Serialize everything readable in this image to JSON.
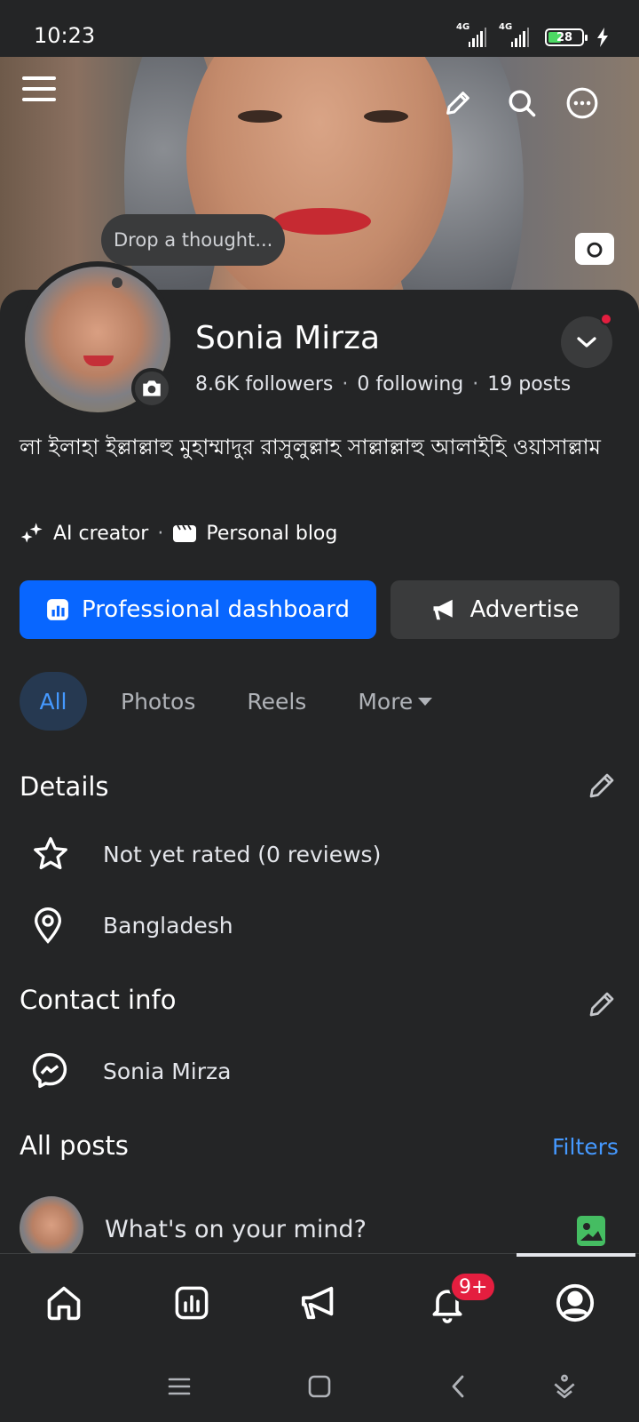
{
  "status_bar": {
    "time": "10:23",
    "signal_1": "4G",
    "signal_2": "4G",
    "battery": "28"
  },
  "cover": {
    "thought_placeholder": "Drop a thought..."
  },
  "profile": {
    "name": "Sonia Mirza",
    "followers": "8.6K followers",
    "following": "0 following",
    "posts": "19 posts",
    "stats_separator": "·",
    "bio": "লা ইলাহা ইল্লাল্লাহু মুহাম্মাদুর রাসুলুল্লাহ সাল্লাল্লাহু আলাইহি ওয়াসাল্লাম",
    "tags": [
      "AI creator",
      "Personal blog"
    ],
    "tag_separator": "·"
  },
  "actions": {
    "primary": "Professional dashboard",
    "secondary": "Advertise"
  },
  "tabs": {
    "items": [
      "All",
      "Photos",
      "Reels",
      "More"
    ],
    "active": "All"
  },
  "details": {
    "title": "Details",
    "rating": "Not yet rated (0 reviews)",
    "location": "Bangladesh"
  },
  "contact": {
    "title": "Contact info",
    "messenger": "Sonia Mirza"
  },
  "posts": {
    "title": "All posts",
    "filters": "Filters",
    "composer_prompt": "What's on your mind?"
  },
  "bottom_nav": {
    "items": [
      "home-icon",
      "dashboard-icon",
      "megaphone-icon",
      "bell-icon",
      "profile-icon"
    ],
    "notification_badge": "9+"
  },
  "colors": {
    "background": "#242526",
    "primary_button": "#0866ff",
    "link": "#4599ff",
    "badge": "#e41e3f"
  }
}
